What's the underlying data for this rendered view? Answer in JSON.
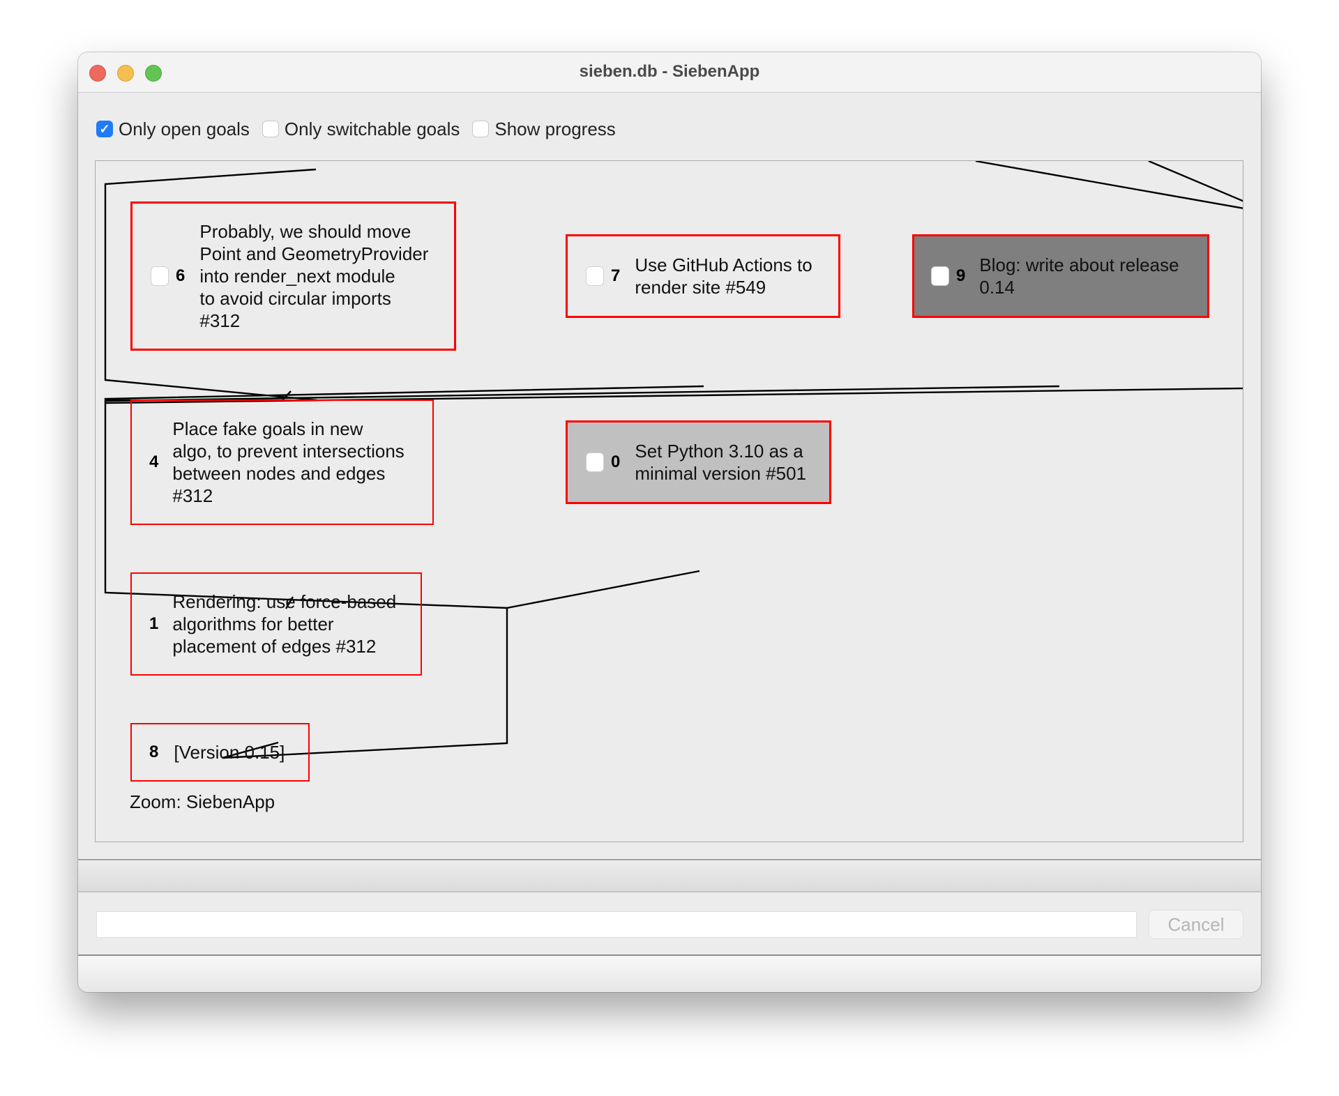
{
  "window": {
    "title": "sieben.db - SiebenApp"
  },
  "toolbar": {
    "options": [
      {
        "label": "Only open goals",
        "checked": true
      },
      {
        "label": "Only switchable goals",
        "checked": false
      },
      {
        "label": "Show progress",
        "checked": false
      }
    ]
  },
  "goals": [
    {
      "id": "6",
      "text": "Probably, we should move\nPoint and GeometryProvider\ninto render_next module\nto avoid circular imports\n#312",
      "has_checkbox": true,
      "style": "open"
    },
    {
      "id": "7",
      "text": "Use GitHub Actions to\nrender site #549",
      "has_checkbox": true,
      "style": "open"
    },
    {
      "id": "9",
      "text": "Blog: write about release\n0.14",
      "has_checkbox": true,
      "style": "selected-dark"
    },
    {
      "id": "4",
      "text": "Place fake goals in new\nalgo, to prevent intersections\nbetween nodes and edges\n#312",
      "has_checkbox": false,
      "style": "open"
    },
    {
      "id": "0",
      "text": "Set Python 3.10 as a\nminimal version #501",
      "has_checkbox": true,
      "style": "selected-light"
    },
    {
      "id": "1",
      "text": "Rendering: use force-based\nalgorithms for better\nplacement of edges #312",
      "has_checkbox": false,
      "style": "open"
    },
    {
      "id": "8",
      "text": "[Version 0.15]",
      "has_checkbox": false,
      "style": "open"
    }
  ],
  "status": {
    "zoom_label": "Zoom: SiebenApp"
  },
  "command": {
    "input_value": "",
    "cancel_label": "Cancel"
  },
  "colors": {
    "goal_border": "#ff0000",
    "selected_dark_bg": "#7f7f7f",
    "selected_light_bg": "#c0c0c0",
    "checkbox_accent": "#1f7cf6"
  }
}
